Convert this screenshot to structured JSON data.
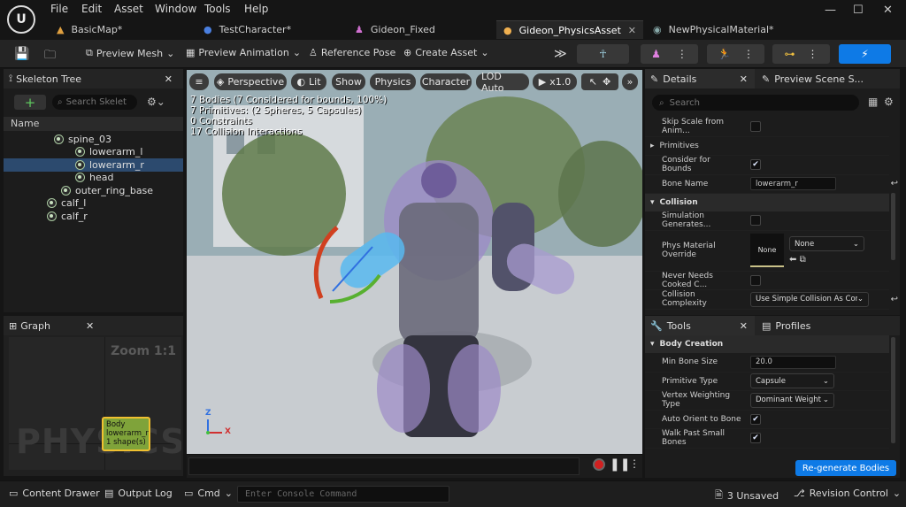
{
  "menu": [
    "File",
    "Edit",
    "Asset",
    "Window",
    "Tools",
    "Help"
  ],
  "tabs": [
    {
      "label": "BasicMap*"
    },
    {
      "label": "TestCharacter*"
    },
    {
      "label": "Gideon_Fixed"
    },
    {
      "label": "Gideon_PhysicsAsset"
    },
    {
      "label": "NewPhysicalMaterial*"
    }
  ],
  "toolbar": {
    "preview_mesh": "Preview Mesh",
    "preview_animation": "Preview Animation",
    "reference_pose": "Reference Pose",
    "create_asset": "Create Asset"
  },
  "skeleton_tree": {
    "title": "Skeleton Tree",
    "search_placeholder": "Search Skelet",
    "column_name": "Name",
    "bones": [
      "spine_03",
      "lowerarm_l",
      "lowerarm_r",
      "head",
      "outer_ring_base",
      "calf_l",
      "calf_r"
    ],
    "selected": "lowerarm_r"
  },
  "graph": {
    "title": "Graph",
    "zoom": "Zoom 1:1",
    "watermark": "PHYSICS",
    "node_title": "Body",
    "node_bone": "lowerarm_r",
    "node_shapes": "1 shape(s)"
  },
  "viewport": {
    "perspective": "Perspective",
    "lit": "Lit",
    "show": "Show",
    "physics": "Physics",
    "character": "Character",
    "lod": "LOD Auto",
    "speed": "x1.0",
    "stats": [
      "7 Bodies (7 Considered for bounds, 100%)",
      "7 Primitives: (2 Spheres, 5 Capsules)",
      "0 Constraints",
      "17 Collision Interactions"
    ],
    "axis_z": "Z",
    "axis_x": "X"
  },
  "details": {
    "tab_details": "Details",
    "tab_preview": "Preview Scene S...",
    "search_placeholder": "Search",
    "skip_scale": "Skip Scale from Anim...",
    "primitives": "Primitives",
    "consider_bounds": "Consider for Bounds",
    "bone_name_label": "Bone Name",
    "bone_name_value": "lowerarm_r",
    "collision_section": "Collision",
    "sim_generates": "Simulation Generates...",
    "phys_mat_label": "Phys Material Override",
    "phys_mat_thumb": "None",
    "phys_mat_value": "None",
    "never_needs": "Never Needs Cooked C...",
    "complexity_label": "Collision Complexity",
    "complexity_value": "Use Simple Collision As Com"
  },
  "tools": {
    "tab_tools": "Tools",
    "tab_profiles": "Profiles",
    "section": "Body Creation",
    "min_bone_label": "Min Bone Size",
    "min_bone_value": "20.0",
    "prim_type_label": "Primitive Type",
    "prim_type_value": "Capsule",
    "vertex_label": "Vertex Weighting Type",
    "vertex_value": "Dominant Weight",
    "auto_orient": "Auto Orient to Bone",
    "walk_past": "Walk Past Small Bones",
    "regen": "Re-generate Bodies"
  },
  "bottom": {
    "content_drawer": "Content Drawer",
    "output_log": "Output Log",
    "cmd": "Cmd",
    "console_placeholder": "Enter Console Command",
    "unsaved": "3 Unsaved",
    "revision": "Revision Control"
  },
  "colors": {
    "accent": "#0e7ae6",
    "selection": "#2c4a6e",
    "node": "#7fa33a"
  }
}
